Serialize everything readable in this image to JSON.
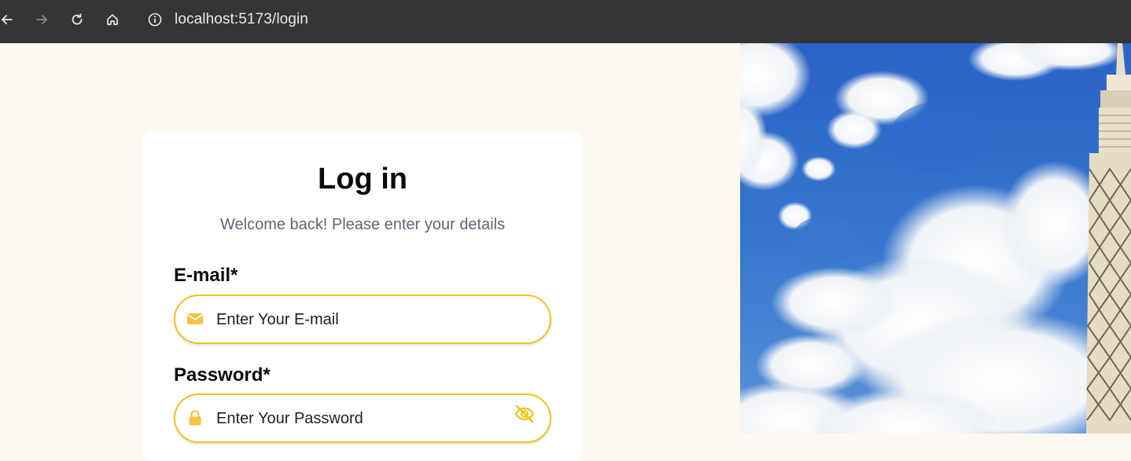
{
  "browser": {
    "url": "localhost:5173/login"
  },
  "login": {
    "title": "Log in",
    "subtitle": "Welcome back! Please enter your details",
    "email_label": "E-mail*",
    "email_placeholder": "Enter Your E-mail",
    "password_label": "Password*",
    "password_placeholder": "Enter Your Password"
  },
  "icons": {
    "back": "arrow-left-icon",
    "forward": "arrow-right-icon",
    "reload": "reload-icon",
    "home": "home-icon",
    "site_info": "info-icon",
    "email": "envelope-icon",
    "password": "lock-icon",
    "toggle_password": "eye-slash-icon"
  },
  "colors": {
    "accent": "#f1c21b",
    "page_background": "#fdf9f2",
    "card_background": "#ffffff",
    "browser_bar": "#353535",
    "sky": "#2f6dcc"
  }
}
